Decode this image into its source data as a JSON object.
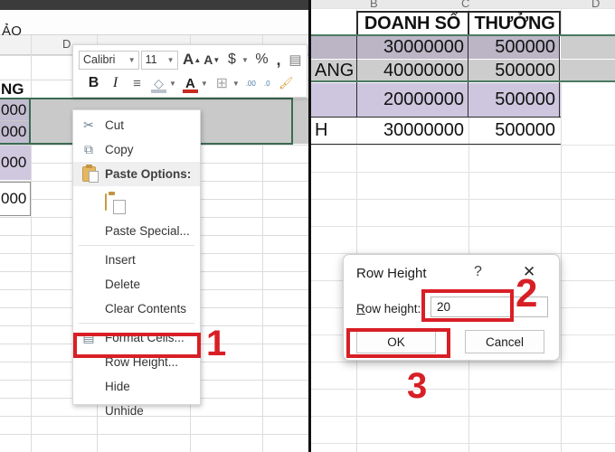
{
  "app": {
    "name": "Microsoft Excel",
    "formula_bar_text": "ẢO"
  },
  "left_pane": {
    "column_letters": [
      "D"
    ],
    "cells": [
      {
        "text": "NG",
        "style": "bold"
      },
      {
        "text": "000",
        "style": "sel-dark"
      },
      {
        "text": "000",
        "style": "sel-dark"
      },
      {
        "text": "000",
        "style": "sel-light"
      },
      {
        "text": "000",
        "style": "plain"
      }
    ]
  },
  "right_pane": {
    "column_letters": [
      "B",
      "C",
      "D"
    ],
    "headers": [
      "DOANH SỐ",
      "THƯỞNG"
    ],
    "rows": [
      {
        "label": "",
        "doanh_so": "30000000",
        "thuong": "500000"
      },
      {
        "label": "ANG",
        "doanh_so": "40000000",
        "thuong": "500000"
      },
      {
        "label": "",
        "doanh_so": "20000000",
        "thuong": "500000"
      },
      {
        "label": "H",
        "doanh_so": "30000000",
        "thuong": "500000"
      }
    ]
  },
  "mini_toolbar": {
    "font_name": "Calibri",
    "font_size": "11",
    "buttons_row1": [
      {
        "name": "grow-font-icon",
        "glyph": "A"
      },
      {
        "name": "shrink-font-icon",
        "glyph": "A"
      },
      {
        "name": "accounting-number-format-icon",
        "glyph": "$"
      },
      {
        "name": "percent-style-icon",
        "glyph": "%"
      },
      {
        "name": "comma-style-icon",
        "glyph": ","
      },
      {
        "name": "merge-and-center-icon",
        "glyph": "▤"
      }
    ],
    "buttons_row2": [
      {
        "name": "bold-icon",
        "glyph": "B"
      },
      {
        "name": "italic-icon",
        "glyph": "I"
      },
      {
        "name": "center-align-icon",
        "glyph": "≡"
      },
      {
        "name": "fill-color-icon",
        "glyph": "◇"
      },
      {
        "name": "font-color-icon",
        "glyph": "A"
      },
      {
        "name": "borders-icon",
        "glyph": "⊞"
      },
      {
        "name": "decrease-decimal-icon",
        "glyph": ".00"
      },
      {
        "name": "increase-decimal-icon",
        "glyph": ".0"
      },
      {
        "name": "format-painter-icon",
        "glyph": "🖌"
      }
    ]
  },
  "context_menu": {
    "items": [
      {
        "label": "Cut",
        "icon": "scissors-icon",
        "type": "item"
      },
      {
        "label": "Copy",
        "icon": "copy-icon",
        "type": "item"
      },
      {
        "label": "Paste Options:",
        "icon": "clipboard-icon",
        "type": "header"
      },
      {
        "label": "",
        "icon": "paste-keep-source-formatting-icon",
        "type": "icon-row"
      },
      {
        "label": "Paste Special...",
        "icon": "",
        "type": "item"
      },
      {
        "label": "Insert",
        "icon": "",
        "type": "item"
      },
      {
        "label": "Delete",
        "icon": "",
        "type": "item"
      },
      {
        "label": "Clear Contents",
        "icon": "",
        "type": "item"
      },
      {
        "label": "Format Cells...",
        "icon": "format-cells-icon",
        "type": "item"
      },
      {
        "label": "Row Height...",
        "icon": "",
        "type": "item"
      },
      {
        "label": "Hide",
        "icon": "",
        "type": "item"
      },
      {
        "label": "Unhide",
        "icon": "",
        "type": "item"
      }
    ]
  },
  "dialog": {
    "title": "Row Height",
    "help_glyph": "?",
    "close_glyph": "✕",
    "field_label": "Row height:",
    "field_value": "20",
    "ok_label": "OK",
    "cancel_label": "Cancel"
  },
  "annotations": {
    "accent_color": "#d81f26",
    "step1": "1",
    "step2": "2",
    "step3": "3"
  }
}
